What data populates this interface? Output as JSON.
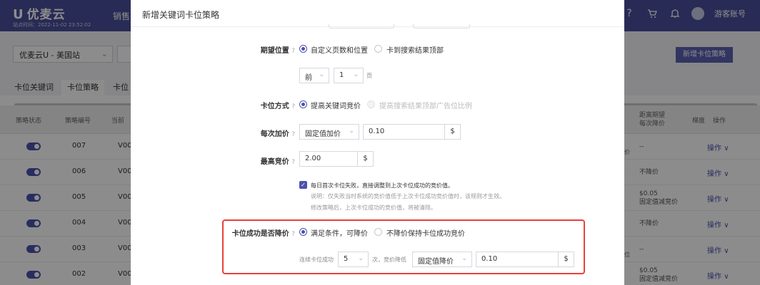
{
  "app": {
    "logo": "优麦云",
    "login_stamp": "站点时间：2022-11-02 23:52:02",
    "nav_first": "销售",
    "account": "游客账号"
  },
  "filters": {
    "site": "优麦云U - 美国站",
    "new_strategy_button": "新增卡位策略"
  },
  "tabs": [
    "卡位关键词",
    "卡位策略",
    "卡位"
  ],
  "table": {
    "headers": [
      "策略状态",
      "策略编号",
      "当前"
    ],
    "right_headers": [
      "距离期望\n每次降价",
      "梯度",
      "操作"
    ],
    "rows": [
      {
        "no": "007",
        "v": "V00",
        "right": "--",
        "op": "操作"
      },
      {
        "no": "006",
        "v": "V00",
        "right": "不降价",
        "op": "操作"
      },
      {
        "no": "005",
        "v": "V00",
        "right": "$0.05\n固定值减竞价",
        "op": "操作"
      },
      {
        "no": "004",
        "v": "V00",
        "right": "不降价",
        "op": "操作"
      },
      {
        "no": "003",
        "v": "V00",
        "right": "--",
        "op": "操作"
      },
      {
        "no": "002",
        "v": "V00",
        "right": "$0.05\n固定值减竞价",
        "op": "操作"
      }
    ],
    "peek_text_1": "价",
    "peek_text_2": "位"
  },
  "modal": {
    "title": "新增关键词卡位策略",
    "expected_position": {
      "label": "期望位置",
      "options": [
        "自定义页数和位置",
        "卡到搜索结果顶部"
      ],
      "selected": 0,
      "page_prefix": "前",
      "page_value": "1",
      "page_suffix": "页"
    },
    "method": {
      "label": "卡位方式",
      "options": [
        "提高关键词竞价",
        "提高搜索结果顶部广告位比例"
      ],
      "selected": 0
    },
    "increment": {
      "label": "每次加价",
      "mode": "固定值加价",
      "value": "0.10",
      "unit": "$"
    },
    "max_bid": {
      "label": "最高竞价",
      "value": "2.00",
      "unit": "$"
    },
    "daily_reset": {
      "checked": true,
      "text": "每日首次卡位失败，直接调整到上次卡位成功的竞价值。",
      "note1": "说明：仅失败当时系统的竞价值低于上次卡位成功竞价值时，该规则才生效。",
      "note2": "修改策略后，上次卡位成功的竞价值，将被清除。"
    },
    "lower_after_success": {
      "label": "卡位成功是否降价",
      "options": [
        "满足条件，可降价",
        "不降价保持卡位成功竞价"
      ],
      "selected": 0,
      "cond_prefix": "连续卡位成功",
      "cond_count": "5",
      "cond_mid": "次，竞价降低",
      "cond_mode": "固定值降价",
      "cond_value": "0.10",
      "cond_unit": "$"
    }
  },
  "colors": {
    "brand": "#4a4f9b",
    "accent": "#4a52ad",
    "highlight": "#e8413a"
  }
}
